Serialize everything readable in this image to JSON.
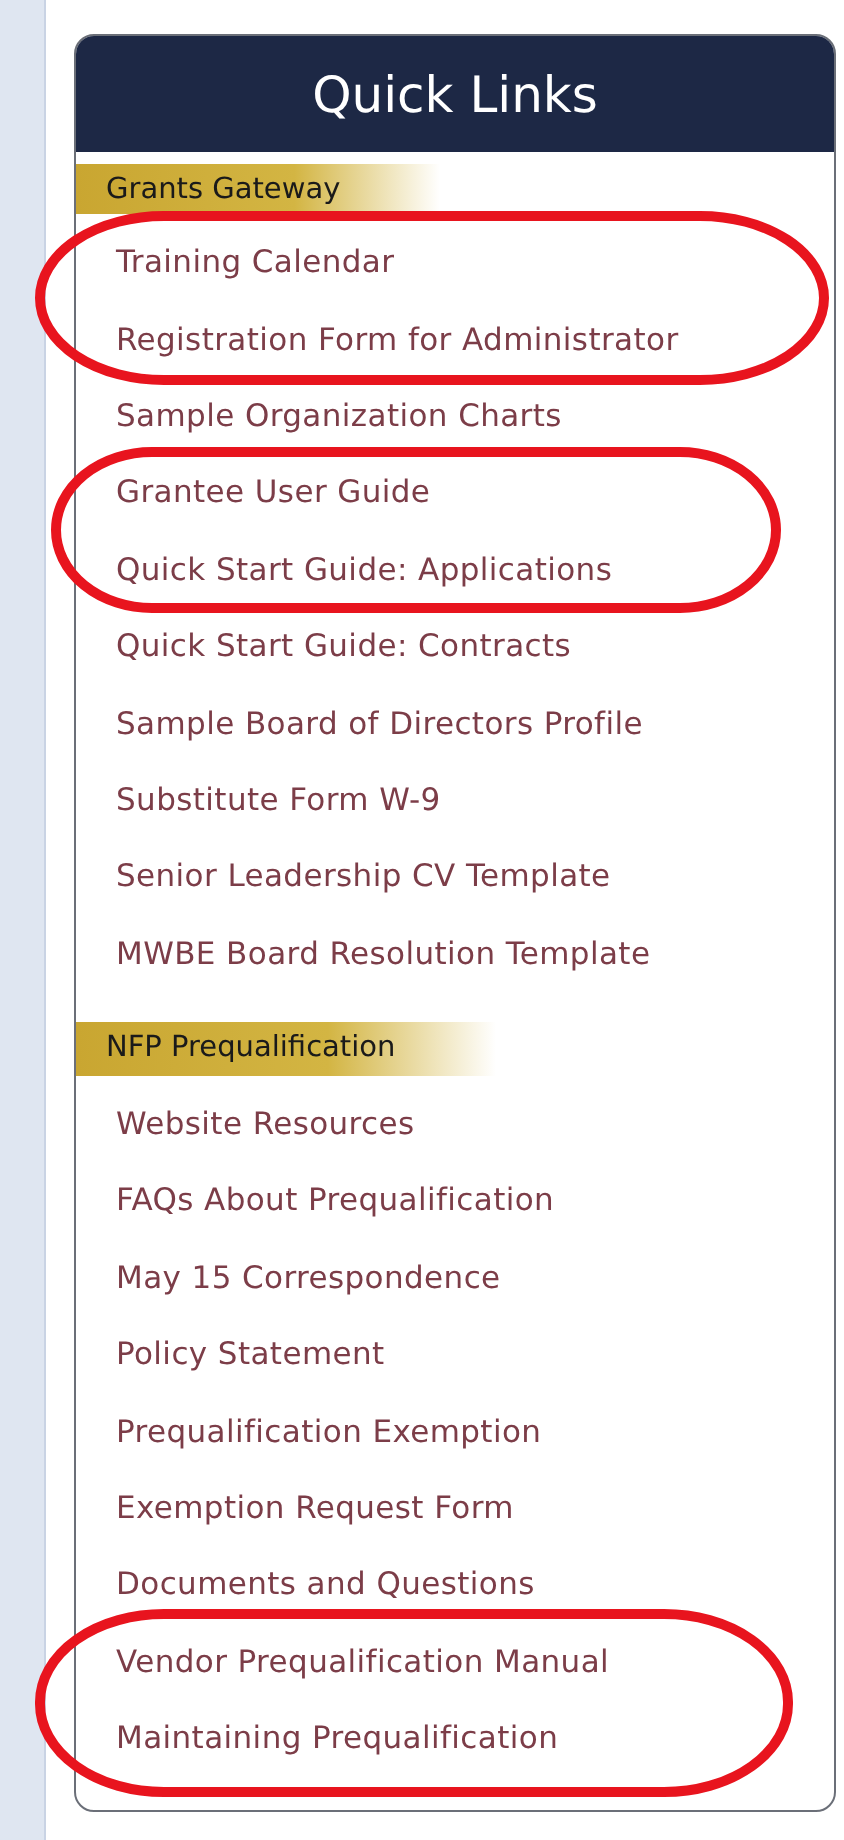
{
  "panel": {
    "title": "Quick Links"
  },
  "sections": [
    {
      "heading": "Grants Gateway",
      "links": [
        "Training Calendar",
        "Registration Form for Administrator",
        "Sample Organization Charts",
        "Grantee User Guide",
        "Quick Start Guide: Applications",
        "Quick Start Guide: Contracts",
        "Sample Board of Directors Profile",
        "Substitute Form W-9",
        "Senior Leadership CV Template",
        "MWBE Board Resolution Template"
      ]
    },
    {
      "heading": "NFP Prequalification",
      "links": [
        "Website Resources",
        "FAQs About Prequalification",
        "May 15 Correspondence",
        "Policy Statement",
        "Prequalification Exemption",
        "Exemption Request Form",
        "Documents and Questions",
        "Vendor Prequalification Manual",
        "Maintaining Prequalification"
      ]
    }
  ],
  "annotations": [
    {
      "kind": "ellipse"
    },
    {
      "kind": "ellipse"
    },
    {
      "kind": "ellipse"
    }
  ]
}
